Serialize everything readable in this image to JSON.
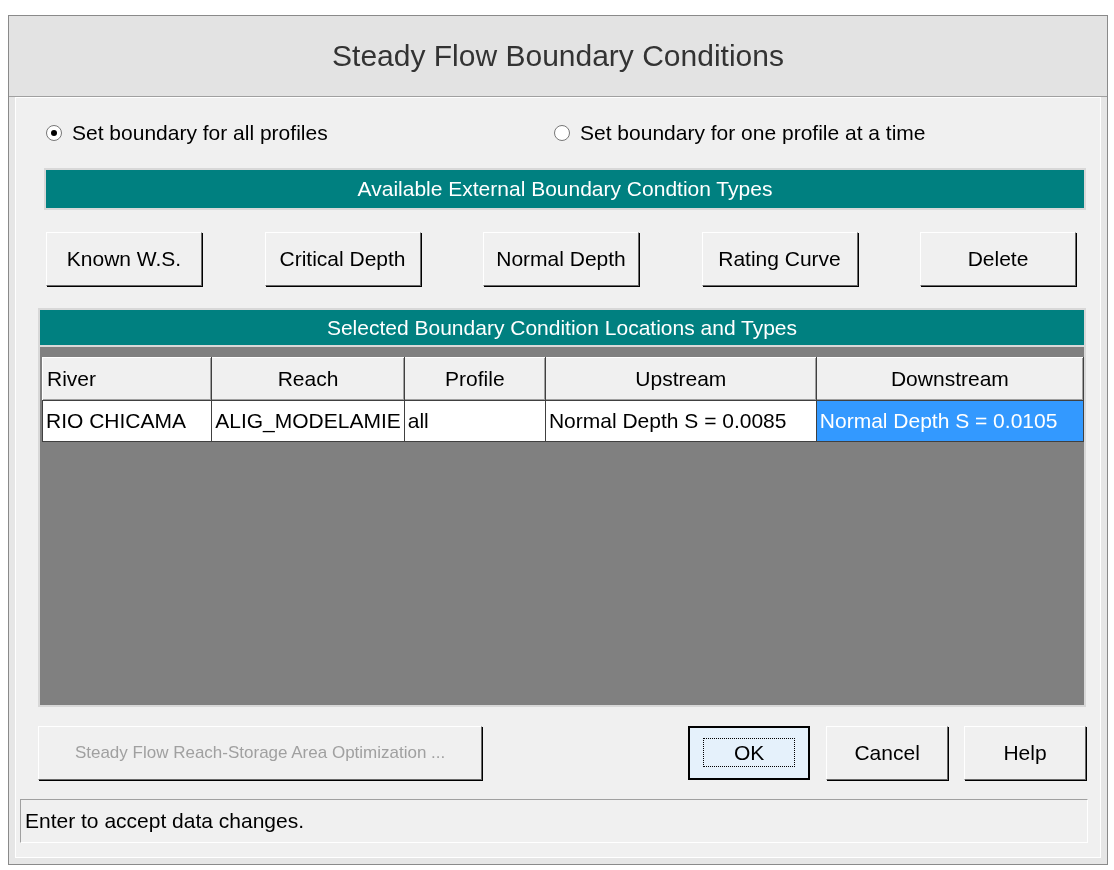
{
  "window": {
    "title": "Steady Flow Boundary Conditions"
  },
  "radio_options": [
    {
      "label": "Set boundary for all profiles",
      "selected": true
    },
    {
      "label": "Set boundary for one profile at a time",
      "selected": false
    }
  ],
  "types_header": "Available External Boundary Condtion Types",
  "type_buttons": [
    "Known W.S.",
    "Critical Depth",
    "Normal Depth",
    "Rating Curve",
    "Delete"
  ],
  "locations_header": "Selected Boundary Condition Locations and Types",
  "table": {
    "columns": [
      "River",
      "Reach",
      "Profile",
      "Upstream",
      "Downstream"
    ],
    "rows": [
      {
        "cells": [
          {
            "text": "RIO CHICAMA",
            "selected": false
          },
          {
            "text": "ALIG_MODELAMIE",
            "selected": false
          },
          {
            "text": "all",
            "selected": false
          },
          {
            "text": "Normal Depth S = 0.0085",
            "selected": false
          },
          {
            "text": "Normal Depth S = 0.0105",
            "selected": true
          }
        ]
      }
    ]
  },
  "bottom_buttons": [
    {
      "label": "Steady Flow Reach-Storage Area Optimization ...",
      "disabled": true,
      "focused": false
    },
    {
      "label": "OK",
      "disabled": false,
      "focused": true
    },
    {
      "label": "Cancel",
      "disabled": false,
      "focused": false
    },
    {
      "label": "Help",
      "disabled": false,
      "focused": false
    }
  ],
  "status_bar": "Enter to accept data changes."
}
